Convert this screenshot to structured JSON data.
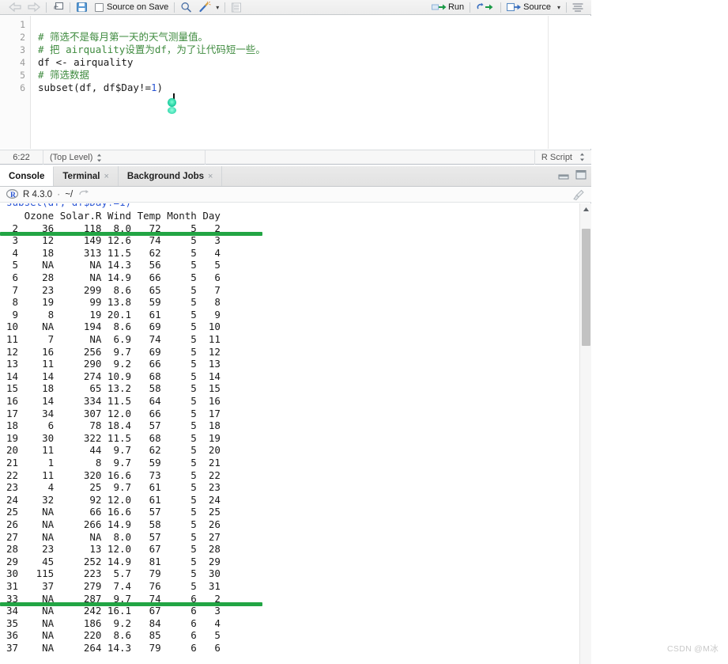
{
  "editor_toolbar": {
    "back_icon": "back-arrow-icon",
    "forward_icon": "forward-arrow-icon",
    "popout_icon": "show-in-new-window-icon",
    "save_icon": "save-icon",
    "source_on_save_label": "Source on Save",
    "find_icon": "find-replace-icon",
    "codetools_icon": "magic-wand-icon",
    "codetools_caret": "▾",
    "outline_icon": "document-outline-icon",
    "run_label": "Run",
    "run_icon": "run-icon",
    "rerun_icon": "rerun-icon",
    "source_label": "Source",
    "source_icon": "source-icon",
    "source_caret": "▾",
    "menu_icon": "editor-menu-icon"
  },
  "editor": {
    "gutter_numbers": [
      "1",
      "2",
      "3",
      "4",
      "5",
      "6"
    ],
    "lines": [
      {
        "n": 1,
        "segments": []
      },
      {
        "n": 2,
        "segments": [
          {
            "t": "comment",
            "s": "# 筛选不是每月第一天的天气测量值。"
          }
        ]
      },
      {
        "n": 3,
        "segments": [
          {
            "t": "comment",
            "s": "# 把 airquality设置为df，为了让代码短一些。"
          }
        ]
      },
      {
        "n": 4,
        "segments": [
          {
            "t": "plain",
            "s": "df <- airquality"
          }
        ]
      },
      {
        "n": 5,
        "segments": [
          {
            "t": "comment",
            "s": "# 筛选数据"
          }
        ]
      },
      {
        "n": 6,
        "segments": [
          {
            "t": "plain",
            "s": "subset(df, df$Day!="
          },
          {
            "t": "number",
            "s": "1"
          },
          {
            "t": "plain",
            "s": ")"
          }
        ]
      }
    ]
  },
  "editor_status": {
    "cursor_position": "6:22",
    "scope": "(Top Level)",
    "file_type": "R Script"
  },
  "console_tabs": [
    {
      "label": "Console",
      "active": true,
      "closable": false
    },
    {
      "label": "Terminal",
      "active": false,
      "closable": true
    },
    {
      "label": "Background Jobs",
      "active": false,
      "closable": true
    }
  ],
  "panel_controls": {
    "minimize_icon": "minimize-panel-icon",
    "maximize_icon": "maximize-panel-icon"
  },
  "console_header": {
    "r_logo": "r-logo-icon",
    "version": "R 4.3.0",
    "separator": "·",
    "working_dir": "~/",
    "expand_icon": "expand-path-icon",
    "clear_icon": "broom-clear-console-icon"
  },
  "console_output": {
    "columns": [
      "",
      "Ozone",
      "Solar.R",
      "Wind",
      "Temp",
      "Month",
      "Day"
    ],
    "header_line": "   Ozone Solar.R Wind Temp Month Day",
    "rows": [
      {
        "id": "2",
        "Ozone": "36",
        "Solar.R": "118",
        "Wind": "8.0",
        "Temp": "72",
        "Month": "5",
        "Day": "2"
      },
      {
        "id": "3",
        "Ozone": "12",
        "Solar.R": "149",
        "Wind": "12.6",
        "Temp": "74",
        "Month": "5",
        "Day": "3"
      },
      {
        "id": "4",
        "Ozone": "18",
        "Solar.R": "313",
        "Wind": "11.5",
        "Temp": "62",
        "Month": "5",
        "Day": "4"
      },
      {
        "id": "5",
        "Ozone": "NA",
        "Solar.R": "NA",
        "Wind": "14.3",
        "Temp": "56",
        "Month": "5",
        "Day": "5"
      },
      {
        "id": "6",
        "Ozone": "28",
        "Solar.R": "NA",
        "Wind": "14.9",
        "Temp": "66",
        "Month": "5",
        "Day": "6"
      },
      {
        "id": "7",
        "Ozone": "23",
        "Solar.R": "299",
        "Wind": "8.6",
        "Temp": "65",
        "Month": "5",
        "Day": "7"
      },
      {
        "id": "8",
        "Ozone": "19",
        "Solar.R": "99",
        "Wind": "13.8",
        "Temp": "59",
        "Month": "5",
        "Day": "8"
      },
      {
        "id": "9",
        "Ozone": "8",
        "Solar.R": "19",
        "Wind": "20.1",
        "Temp": "61",
        "Month": "5",
        "Day": "9"
      },
      {
        "id": "10",
        "Ozone": "NA",
        "Solar.R": "194",
        "Wind": "8.6",
        "Temp": "69",
        "Month": "5",
        "Day": "10"
      },
      {
        "id": "11",
        "Ozone": "7",
        "Solar.R": "NA",
        "Wind": "6.9",
        "Temp": "74",
        "Month": "5",
        "Day": "11"
      },
      {
        "id": "12",
        "Ozone": "16",
        "Solar.R": "256",
        "Wind": "9.7",
        "Temp": "69",
        "Month": "5",
        "Day": "12"
      },
      {
        "id": "13",
        "Ozone": "11",
        "Solar.R": "290",
        "Wind": "9.2",
        "Temp": "66",
        "Month": "5",
        "Day": "13"
      },
      {
        "id": "14",
        "Ozone": "14",
        "Solar.R": "274",
        "Wind": "10.9",
        "Temp": "68",
        "Month": "5",
        "Day": "14"
      },
      {
        "id": "15",
        "Ozone": "18",
        "Solar.R": "65",
        "Wind": "13.2",
        "Temp": "58",
        "Month": "5",
        "Day": "15"
      },
      {
        "id": "16",
        "Ozone": "14",
        "Solar.R": "334",
        "Wind": "11.5",
        "Temp": "64",
        "Month": "5",
        "Day": "16"
      },
      {
        "id": "17",
        "Ozone": "34",
        "Solar.R": "307",
        "Wind": "12.0",
        "Temp": "66",
        "Month": "5",
        "Day": "17"
      },
      {
        "id": "18",
        "Ozone": "6",
        "Solar.R": "78",
        "Wind": "18.4",
        "Temp": "57",
        "Month": "5",
        "Day": "18"
      },
      {
        "id": "19",
        "Ozone": "30",
        "Solar.R": "322",
        "Wind": "11.5",
        "Temp": "68",
        "Month": "5",
        "Day": "19"
      },
      {
        "id": "20",
        "Ozone": "11",
        "Solar.R": "44",
        "Wind": "9.7",
        "Temp": "62",
        "Month": "5",
        "Day": "20"
      },
      {
        "id": "21",
        "Ozone": "1",
        "Solar.R": "8",
        "Wind": "9.7",
        "Temp": "59",
        "Month": "5",
        "Day": "21"
      },
      {
        "id": "22",
        "Ozone": "11",
        "Solar.R": "320",
        "Wind": "16.6",
        "Temp": "73",
        "Month": "5",
        "Day": "22"
      },
      {
        "id": "23",
        "Ozone": "4",
        "Solar.R": "25",
        "Wind": "9.7",
        "Temp": "61",
        "Month": "5",
        "Day": "23"
      },
      {
        "id": "24",
        "Ozone": "32",
        "Solar.R": "92",
        "Wind": "12.0",
        "Temp": "61",
        "Month": "5",
        "Day": "24"
      },
      {
        "id": "25",
        "Ozone": "NA",
        "Solar.R": "66",
        "Wind": "16.6",
        "Temp": "57",
        "Month": "5",
        "Day": "25"
      },
      {
        "id": "26",
        "Ozone": "NA",
        "Solar.R": "266",
        "Wind": "14.9",
        "Temp": "58",
        "Month": "5",
        "Day": "26"
      },
      {
        "id": "27",
        "Ozone": "NA",
        "Solar.R": "NA",
        "Wind": "8.0",
        "Temp": "57",
        "Month": "5",
        "Day": "27"
      },
      {
        "id": "28",
        "Ozone": "23",
        "Solar.R": "13",
        "Wind": "12.0",
        "Temp": "67",
        "Month": "5",
        "Day": "28"
      },
      {
        "id": "29",
        "Ozone": "45",
        "Solar.R": "252",
        "Wind": "14.9",
        "Temp": "81",
        "Month": "5",
        "Day": "29"
      },
      {
        "id": "30",
        "Ozone": "115",
        "Solar.R": "223",
        "Wind": "5.7",
        "Temp": "79",
        "Month": "5",
        "Day": "30"
      },
      {
        "id": "31",
        "Ozone": "37",
        "Solar.R": "279",
        "Wind": "7.4",
        "Temp": "76",
        "Month": "5",
        "Day": "31"
      },
      {
        "id": "33",
        "Ozone": "NA",
        "Solar.R": "287",
        "Wind": "9.7",
        "Temp": "74",
        "Month": "6",
        "Day": "2"
      },
      {
        "id": "34",
        "Ozone": "NA",
        "Solar.R": "242",
        "Wind": "16.1",
        "Temp": "67",
        "Month": "6",
        "Day": "3"
      },
      {
        "id": "35",
        "Ozone": "NA",
        "Solar.R": "186",
        "Wind": "9.2",
        "Temp": "84",
        "Month": "6",
        "Day": "4"
      },
      {
        "id": "36",
        "Ozone": "NA",
        "Solar.R": "220",
        "Wind": "8.6",
        "Temp": "85",
        "Month": "6",
        "Day": "5"
      },
      {
        "id": "37",
        "Ozone": "NA",
        "Solar.R": "264",
        "Wind": "14.3",
        "Temp": "79",
        "Month": "6",
        "Day": "6"
      }
    ],
    "annotations": [
      {
        "name": "highlight-row-2",
        "row_id": "2",
        "color": "#22a544"
      },
      {
        "name": "highlight-row-33",
        "row_id": "33",
        "color": "#22a544"
      }
    ]
  },
  "watermark": {
    "text": "CSDN @M冰"
  },
  "colors": {
    "accent_green": "#22a544",
    "comment_green": "#3f8b3f",
    "number_blue": "#2a55d4",
    "chrome_gray": "#e7e7e7"
  }
}
